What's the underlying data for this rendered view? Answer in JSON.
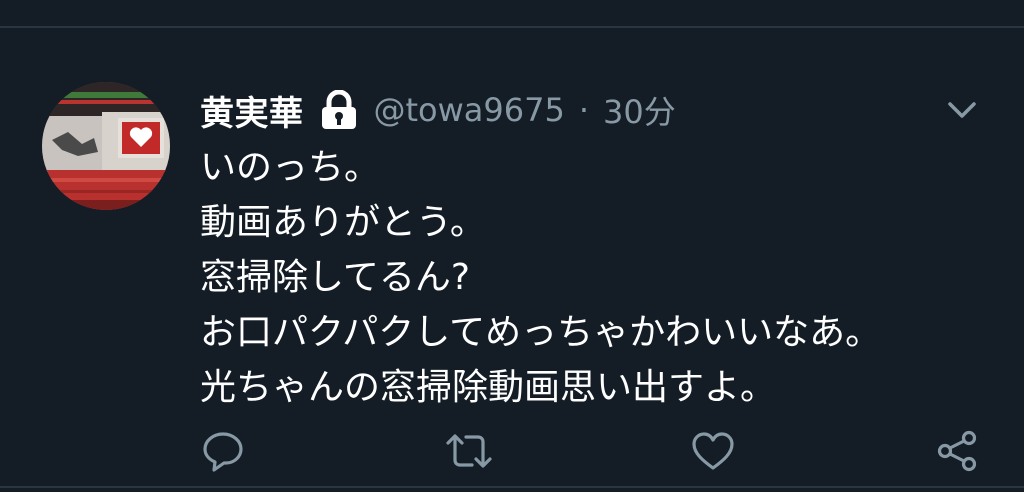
{
  "tweet": {
    "display_name": "黄実華",
    "handle": "@towa9675",
    "separator": "·",
    "time": "30分",
    "protected_icon": "lock-icon",
    "menu_icon": "chevron-down-icon",
    "avatar": "profile-photo",
    "lines": [
      "いのっち。",
      "動画ありがとう。",
      "窓掃除してるん?",
      "お口パクパクしてめっちゃかわいいなあ。",
      "光ちゃんの窓掃除動画思い出すよ。"
    ]
  },
  "actions": [
    {
      "icon": "reply-icon"
    },
    {
      "icon": "retweet-icon"
    },
    {
      "icon": "like-icon"
    },
    {
      "icon": "share-icon"
    }
  ],
  "colors": {
    "background": "#141d26",
    "primary_text": "#ffffff",
    "secondary_text": "#8899a6",
    "divider": "#2a3542"
  }
}
